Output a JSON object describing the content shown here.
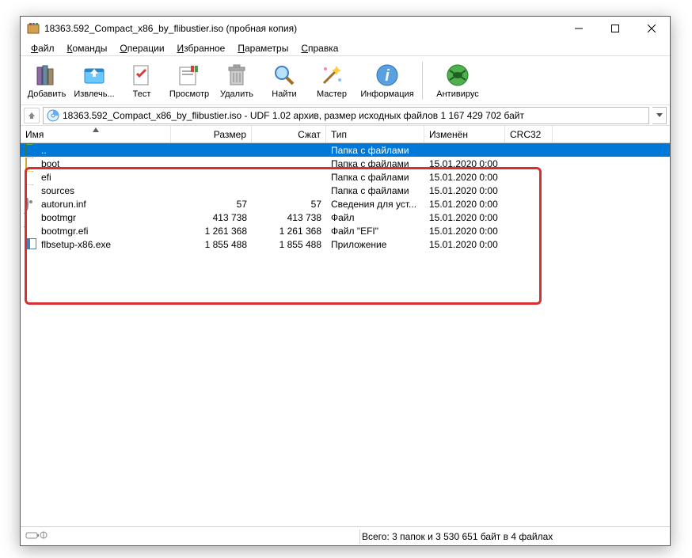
{
  "window": {
    "title": "18363.592_Compact_x86_by_flibustier.iso (пробная копия)"
  },
  "menu": {
    "items": [
      {
        "label": "Файл",
        "u": 0
      },
      {
        "label": "Команды",
        "u": 0
      },
      {
        "label": "Операции",
        "u": 0
      },
      {
        "label": "Избранное",
        "u": 0
      },
      {
        "label": "Параметры",
        "u": 0
      },
      {
        "label": "Справка",
        "u": 0
      }
    ]
  },
  "toolbar": {
    "add": "Добавить",
    "extract": "Извлечь...",
    "test": "Тест",
    "view": "Просмотр",
    "delete": "Удалить",
    "find": "Найти",
    "wizard": "Мастер",
    "info": "Информация",
    "antivirus": "Антивирус"
  },
  "path": {
    "text": "18363.592_Compact_x86_by_flibustier.iso - UDF 1.02 архив, размер исходных файлов 1 167 429 702 байт"
  },
  "columns": {
    "name": "Имя",
    "size": "Размер",
    "packed": "Сжат",
    "type": "Тип",
    "modified": "Изменён",
    "crc": "CRC32"
  },
  "rows": [
    {
      "icon": "up",
      "name": "..",
      "size": "",
      "packed": "",
      "type": "Папка с файлами",
      "modified": "",
      "selected": true
    },
    {
      "icon": "folder",
      "name": "boot",
      "size": "",
      "packed": "",
      "type": "Папка с файлами",
      "modified": "15.01.2020 0:00"
    },
    {
      "icon": "folder",
      "name": "efi",
      "size": "",
      "packed": "",
      "type": "Папка с файлами",
      "modified": "15.01.2020 0:00"
    },
    {
      "icon": "folder",
      "name": "sources",
      "size": "",
      "packed": "",
      "type": "Папка с файлами",
      "modified": "15.01.2020 0:00"
    },
    {
      "icon": "gear",
      "name": "autorun.inf",
      "size": "57",
      "packed": "57",
      "type": "Сведения для уст...",
      "modified": "15.01.2020 0:00"
    },
    {
      "icon": "file",
      "name": "bootmgr",
      "size": "413 738",
      "packed": "413 738",
      "type": "Файл",
      "modified": "15.01.2020 0:00"
    },
    {
      "icon": "file",
      "name": "bootmgr.efi",
      "size": "1 261 368",
      "packed": "1 261 368",
      "type": "Файл \"EFI\"",
      "modified": "15.01.2020 0:00"
    },
    {
      "icon": "exe",
      "name": "flbsetup-x86.exe",
      "size": "1 855 488",
      "packed": "1 855 488",
      "type": "Приложение",
      "modified": "15.01.2020 0:00"
    }
  ],
  "status": {
    "total": "Всего: 3 папок и 3 530 651 байт в 4 файлах"
  }
}
